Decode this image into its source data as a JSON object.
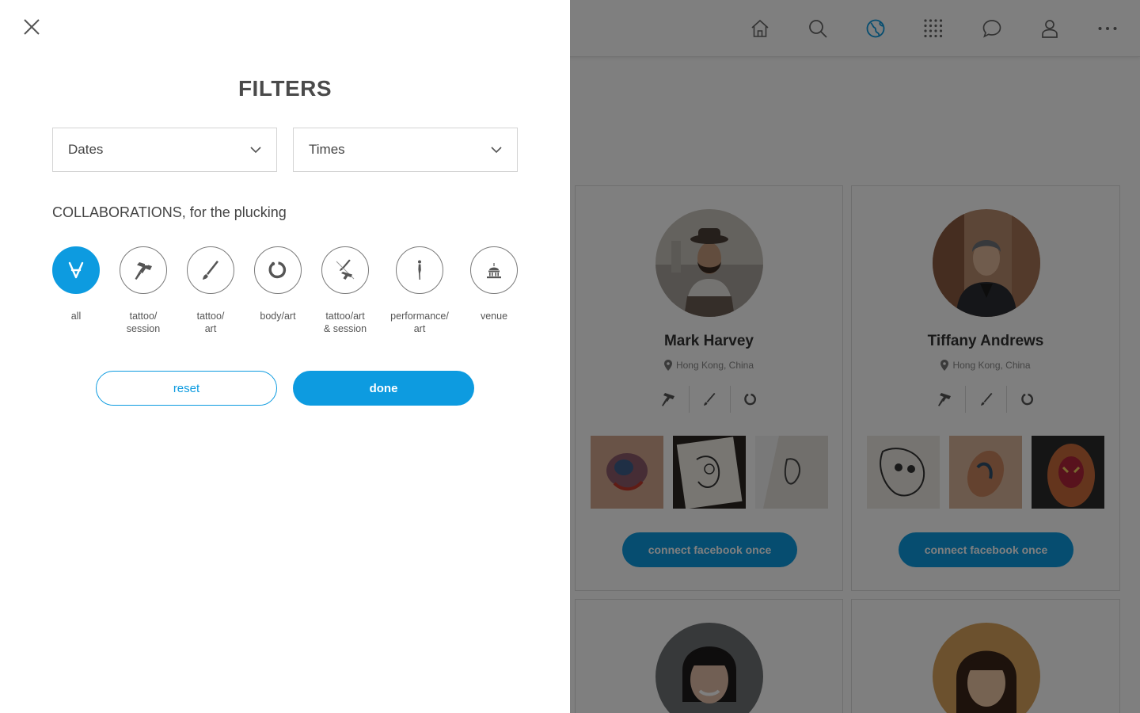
{
  "filters": {
    "title": "FILTERS",
    "dates_label": "Dates",
    "times_label": "Times",
    "collab_heading": "COLLABORATIONS, for the plucking",
    "chips": [
      {
        "label": "all",
        "icon": "for-all-icon",
        "active": true
      },
      {
        "label": "tattoo/\nsession",
        "icon": "tattoo-machine-icon",
        "active": false
      },
      {
        "label": "tattoo/\nart",
        "icon": "paintbrush-icon",
        "active": false
      },
      {
        "label": "body/art",
        "icon": "piercing-ring-icon",
        "active": false
      },
      {
        "label": "tattoo/art\n& session",
        "icon": "brush-and-machine-icon",
        "active": false
      },
      {
        "label": "performance/\nart",
        "icon": "performer-icon",
        "active": false
      },
      {
        "label": "venue",
        "icon": "venue-building-icon",
        "active": false
      }
    ],
    "reset_label": "reset",
    "done_label": "done"
  },
  "nav": {
    "icons": [
      "home-icon",
      "search-icon",
      "globe-icon",
      "grid-dots-icon",
      "chat-icon",
      "profile-icon",
      "more-icon"
    ],
    "active": "globe-icon"
  },
  "cards": [
    {
      "name": "Mark Harvey",
      "location": "Hong Kong, China",
      "button": "connect facebook once"
    },
    {
      "name": "Tiffany Andrews",
      "location": "Hong Kong, China",
      "button": "connect facebook once"
    }
  ],
  "colors": {
    "accent": "#0d9be0",
    "overlay": "rgba(0,0,0,0.5)",
    "text": "#444444"
  }
}
